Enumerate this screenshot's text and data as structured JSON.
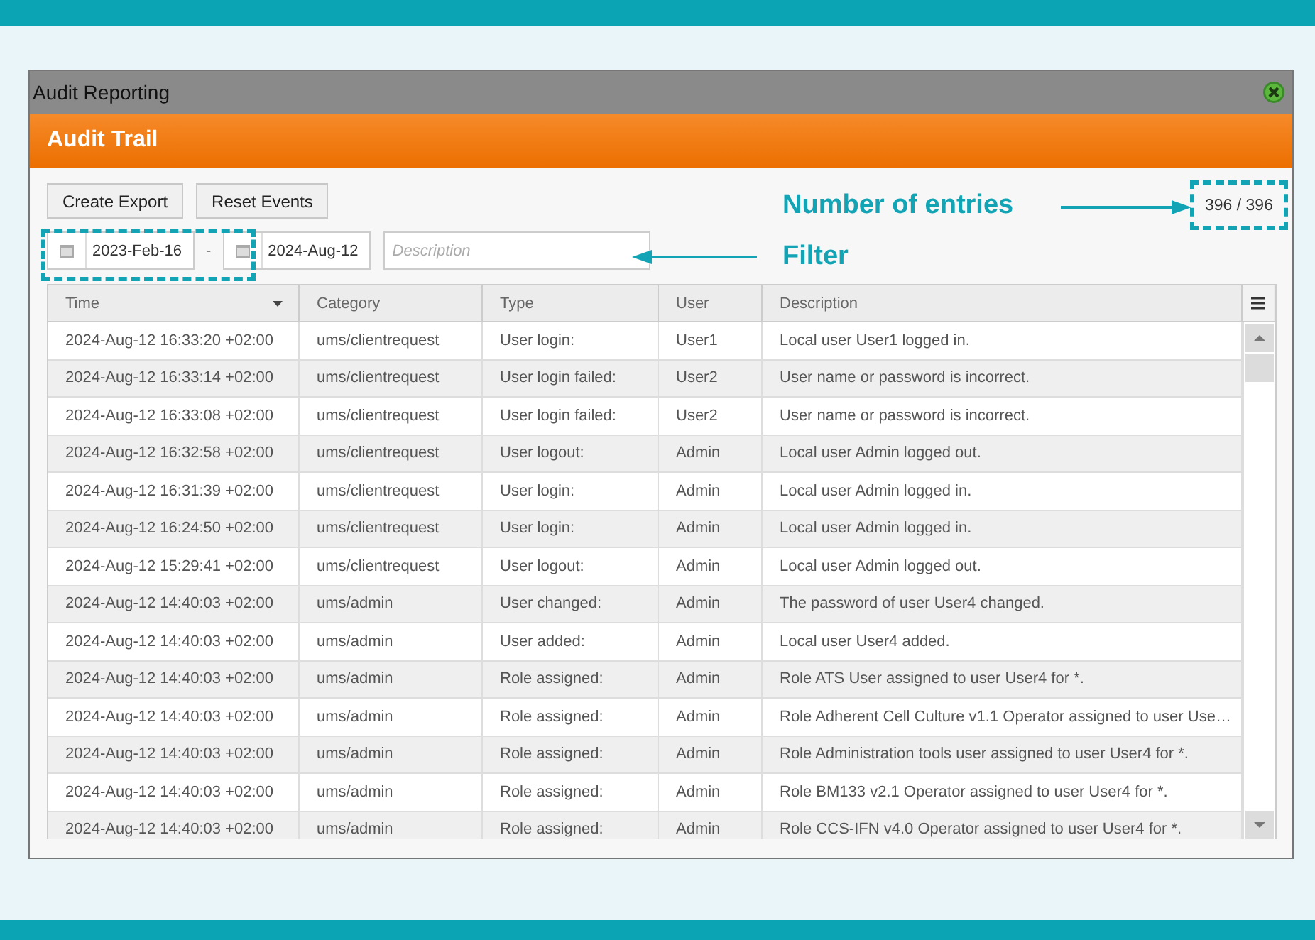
{
  "window": {
    "title": "Audit Reporting"
  },
  "header": {
    "title": "Audit Trail"
  },
  "buttons": [
    "Create Export",
    "Reset Events"
  ],
  "filter": {
    "date_from": "2023-Feb-16",
    "separator": "-",
    "date_to": "2024-Aug-12",
    "description_placeholder": "Description"
  },
  "entry_count": "396 / 396",
  "annotations": [
    {
      "text": "Number of entries",
      "kind": "right"
    },
    {
      "text": "Filter",
      "kind": "left"
    }
  ],
  "table": {
    "columns": [
      {
        "label": "Time",
        "sorted": true
      },
      {
        "label": "Category",
        "sorted": false
      },
      {
        "label": "Type",
        "sorted": false
      },
      {
        "label": "User",
        "sorted": false
      },
      {
        "label": "Description",
        "sorted": false
      }
    ],
    "rows": [
      [
        "2024-Aug-12 16:33:20 +02:00",
        "ums/clientrequest",
        "User login:",
        "User1",
        "Local user User1 logged in."
      ],
      [
        "2024-Aug-12 16:33:14 +02:00",
        "ums/clientrequest",
        "User login failed:",
        "User2",
        "User name or password is incorrect."
      ],
      [
        "2024-Aug-12 16:33:08 +02:00",
        "ums/clientrequest",
        "User login failed:",
        "User2",
        "User name or password is incorrect."
      ],
      [
        "2024-Aug-12 16:32:58 +02:00",
        "ums/clientrequest",
        "User logout:",
        "Admin",
        "Local user Admin logged out."
      ],
      [
        "2024-Aug-12 16:31:39 +02:00",
        "ums/clientrequest",
        "User login:",
        "Admin",
        "Local user Admin logged in."
      ],
      [
        "2024-Aug-12 16:24:50 +02:00",
        "ums/clientrequest",
        "User login:",
        "Admin",
        "Local user Admin logged in."
      ],
      [
        "2024-Aug-12 15:29:41 +02:00",
        "ums/clientrequest",
        "User logout:",
        "Admin",
        "Local user Admin logged out."
      ],
      [
        "2024-Aug-12 14:40:03 +02:00",
        "ums/admin",
        "User changed:",
        "Admin",
        "The password of user User4 changed."
      ],
      [
        "2024-Aug-12 14:40:03 +02:00",
        "ums/admin",
        "User added:",
        "Admin",
        "Local user User4 added."
      ],
      [
        "2024-Aug-12 14:40:03 +02:00",
        "ums/admin",
        "Role assigned:",
        "Admin",
        "Role ATS User assigned to user User4 for *."
      ],
      [
        "2024-Aug-12 14:40:03 +02:00",
        "ums/admin",
        "Role assigned:",
        "Admin",
        "Role Adherent Cell Culture v1.1 Operator assigned to user Use…"
      ],
      [
        "2024-Aug-12 14:40:03 +02:00",
        "ums/admin",
        "Role assigned:",
        "Admin",
        "Role Administration tools user assigned to user User4 for *."
      ],
      [
        "2024-Aug-12 14:40:03 +02:00",
        "ums/admin",
        "Role assigned:",
        "Admin",
        "Role BM133 v2.1 Operator assigned to user User4 for *."
      ],
      [
        "2024-Aug-12 14:40:03 +02:00",
        "ums/admin",
        "Role assigned:",
        "Admin",
        "Role CCS-IFN v4.0 Operator assigned to user User4 for *."
      ]
    ]
  }
}
